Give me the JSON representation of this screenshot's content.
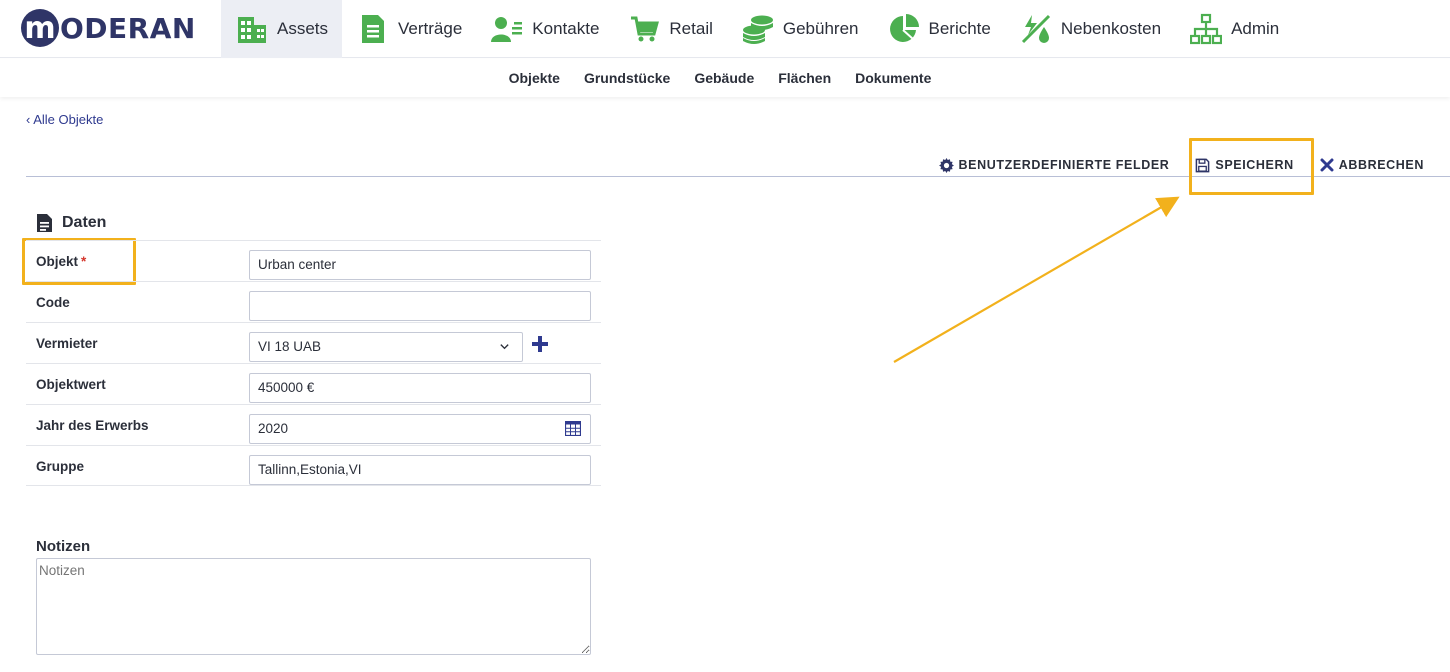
{
  "brand": {
    "logo_letter": "m",
    "logo_text": "ODERAN",
    "color": "#2f3567"
  },
  "nav": {
    "items": [
      {
        "label": "Assets",
        "icon": "building-icon",
        "active": true
      },
      {
        "label": "Verträge",
        "icon": "document-icon"
      },
      {
        "label": "Kontakte",
        "icon": "contacts-icon"
      },
      {
        "label": "Retail",
        "icon": "cart-icon"
      },
      {
        "label": "Gebühren",
        "icon": "coins-icon"
      },
      {
        "label": "Berichte",
        "icon": "pie-chart-icon"
      },
      {
        "label": "Nebenkosten",
        "icon": "utilities-icon"
      },
      {
        "label": "Admin",
        "icon": "org-chart-icon"
      }
    ],
    "icon_color": "#4caf50"
  },
  "subnav": {
    "items": [
      "Objekte",
      "Grundstücke",
      "Gebäude",
      "Flächen",
      "Dokumente"
    ]
  },
  "breadcrumb": {
    "back_label": "‹ Alle Objekte"
  },
  "toolbar": {
    "custom_fields_label": "BENUTZERDEFINIERTE FELDER",
    "save_label": "SPEICHERN",
    "cancel_label": "ABBRECHEN"
  },
  "section": {
    "title": "Daten"
  },
  "form": {
    "object_label": "Objekt",
    "required_mark": "*",
    "object_value": "Urban center",
    "code_label": "Code",
    "code_value": "",
    "landlord_label": "Vermieter",
    "landlord_value": "VI 18 UAB",
    "value_label": "Objektwert",
    "value_value": "450000 €",
    "year_label": "Jahr des Erwerbs",
    "year_value": "2020",
    "group_label": "Gruppe",
    "group_value": "Tallinn,Estonia,VI"
  },
  "notes": {
    "label": "Notizen",
    "placeholder": "Notizen"
  },
  "colors": {
    "highlight": "#f2b11c",
    "accent": "#2f3a8f",
    "required": "#d4352b"
  }
}
